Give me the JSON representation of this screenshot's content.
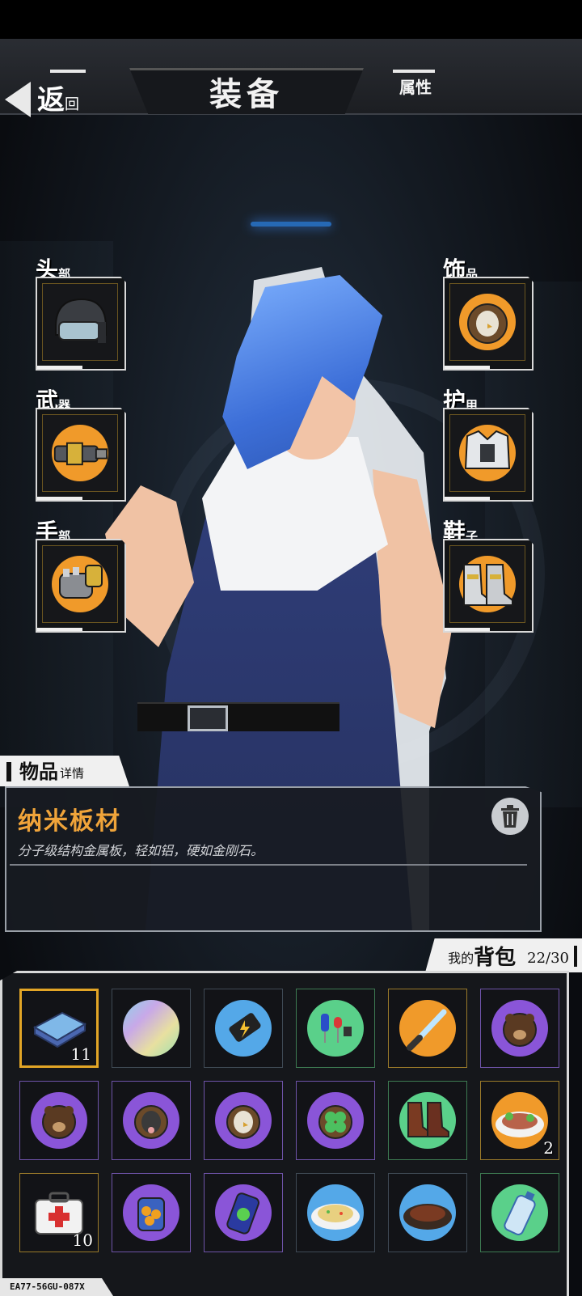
{
  "header": {
    "back_big": "返",
    "back_small": "回",
    "title": "装备",
    "attr_tab": "属性"
  },
  "slots": {
    "head": {
      "big": "头",
      "small": "部"
    },
    "weapon": {
      "big": "武",
      "small": "器"
    },
    "hand": {
      "big": "手",
      "small": "部"
    },
    "accessory": {
      "big": "饰",
      "small": "品"
    },
    "armor": {
      "big": "护",
      "small": "甲"
    },
    "shoes": {
      "big": "鞋",
      "small": "子"
    }
  },
  "detail": {
    "tab_big": "物品",
    "tab_small": "详情",
    "name": "纳米板材",
    "desc": "分子级结构金属板，轻如铝，硬如金刚石。"
  },
  "bag": {
    "small": "我的",
    "big": "背包",
    "count": "22/30",
    "q_plate": "11",
    "q_food": "2",
    "q_medkit": "10"
  },
  "footer_tag": "EA77-56GU-087X",
  "colors": {
    "accent": "#f0a43a",
    "slot_gold": "#e2a526"
  }
}
